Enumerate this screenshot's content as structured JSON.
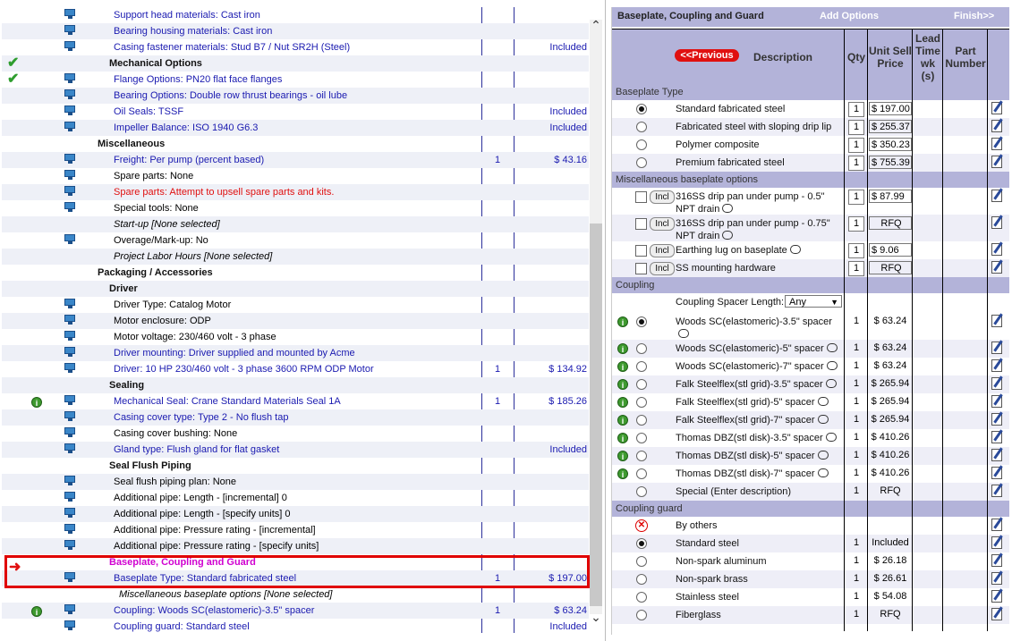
{
  "left_rows": [
    {
      "type": "item",
      "icon": true,
      "text": "Support head materials: Cast iron",
      "color": "blue",
      "qty": "",
      "price": ""
    },
    {
      "type": "item",
      "icon": true,
      "text": "Bearing housing materials: Cast iron",
      "color": "blue",
      "qty": "",
      "price": ""
    },
    {
      "type": "item",
      "icon": true,
      "text": "Casing fastener materials: Stud B7 / Nut SR2H (Steel)",
      "color": "blue",
      "qty": "",
      "price": "Included"
    },
    {
      "type": "h2",
      "check": true,
      "text": "Mechanical Options"
    },
    {
      "type": "item",
      "icon": true,
      "check": true,
      "text": "Flange Options: PN20 flat face flanges",
      "color": "blue",
      "qty": "",
      "price": ""
    },
    {
      "type": "item",
      "icon": true,
      "text": "Bearing Options: Double row thrust bearings - oil lube",
      "color": "blue",
      "qty": "",
      "price": ""
    },
    {
      "type": "item",
      "icon": true,
      "text": "Oil Seals: TSSF",
      "color": "blue",
      "qty": "",
      "price": "Included"
    },
    {
      "type": "item",
      "icon": true,
      "text": "Impeller Balance: ISO 1940 G6.3",
      "color": "blue",
      "qty": "",
      "price": "Included"
    },
    {
      "type": "h1",
      "text": "Miscellaneous"
    },
    {
      "type": "item",
      "icon": true,
      "text": "Freight: Per pump (percent based)",
      "color": "blue",
      "qty": "1",
      "price": "$ 43.16"
    },
    {
      "type": "item",
      "icon": true,
      "text": "Spare parts: None",
      "color": "black",
      "qty": "",
      "price": ""
    },
    {
      "type": "item",
      "icon": true,
      "text": "Spare parts: Attempt to upsell spare parts and kits.",
      "color": "red",
      "qty": "",
      "price": ""
    },
    {
      "type": "item",
      "icon": true,
      "text": "Special tools: None",
      "color": "black",
      "qty": "",
      "price": ""
    },
    {
      "type": "italic",
      "text": "Start-up  [None selected]"
    },
    {
      "type": "item",
      "icon": true,
      "text": "Overage/Mark-up: No",
      "color": "black",
      "qty": "",
      "price": ""
    },
    {
      "type": "italic",
      "text": "Project Labor Hours  [None selected]"
    },
    {
      "type": "h1",
      "text": "Packaging / Accessories"
    },
    {
      "type": "h2",
      "text": "Driver"
    },
    {
      "type": "item",
      "icon": true,
      "text": "Driver Type: Catalog Motor",
      "color": "black",
      "qty": "",
      "price": ""
    },
    {
      "type": "item",
      "icon": true,
      "text": "Motor enclosure: ODP",
      "color": "black",
      "qty": "",
      "price": ""
    },
    {
      "type": "item",
      "icon": true,
      "text": "Motor voltage: 230/460 volt - 3 phase",
      "color": "black",
      "qty": "",
      "price": ""
    },
    {
      "type": "item",
      "icon": true,
      "text": "Driver mounting: Driver supplied and mounted by Acme",
      "color": "blue",
      "qty": "",
      "price": ""
    },
    {
      "type": "item",
      "icon": true,
      "text": "Driver: 10 HP 230/460 volt - 3 phase 3600 RPM ODP Motor",
      "color": "blue",
      "qty": "1",
      "price": "$ 134.92"
    },
    {
      "type": "h2",
      "text": "Sealing"
    },
    {
      "type": "item",
      "icon": true,
      "info": true,
      "text": "Mechanical Seal: Crane Standard Materials Seal 1A",
      "color": "blue",
      "qty": "1",
      "price": "$ 185.26"
    },
    {
      "type": "item",
      "icon": true,
      "text": "Casing cover type: Type 2 - No flush tap",
      "color": "blue",
      "qty": "",
      "price": ""
    },
    {
      "type": "item",
      "icon": true,
      "text": "Casing cover bushing: None",
      "color": "black",
      "qty": "",
      "price": ""
    },
    {
      "type": "item",
      "icon": true,
      "text": "Gland type: Flush gland for flat gasket",
      "color": "blue",
      "qty": "",
      "price": "Included"
    },
    {
      "type": "h2",
      "text": "Seal Flush Piping"
    },
    {
      "type": "item",
      "icon": true,
      "text": "Seal flush piping plan: None",
      "color": "black",
      "qty": "",
      "price": ""
    },
    {
      "type": "item",
      "icon": true,
      "text": "Additional pipe: Length - [incremental] 0",
      "color": "black",
      "qty": "",
      "price": ""
    },
    {
      "type": "item",
      "icon": true,
      "text": "Additional pipe: Length - [specify units] 0",
      "color": "black",
      "qty": "",
      "price": ""
    },
    {
      "type": "item",
      "icon": true,
      "text": "Additional pipe: Pressure rating - [incremental]",
      "color": "black",
      "qty": "",
      "price": ""
    },
    {
      "type": "item",
      "icon": true,
      "text": "Additional pipe: Pressure rating - [specify units]",
      "color": "black",
      "qty": "",
      "price": ""
    },
    {
      "type": "magenta",
      "text": "Baseplate, Coupling and Guard"
    },
    {
      "type": "item",
      "icon": true,
      "text": "Baseplate Type: Standard fabricated steel",
      "color": "blue",
      "qty": "1",
      "price": "$ 197.00"
    },
    {
      "type": "italic2",
      "text": "Miscellaneous baseplate options  [None selected]"
    },
    {
      "type": "item",
      "icon": true,
      "info": true,
      "text": "Coupling: Woods SC(elastomeric)-3.5\" spacer",
      "color": "blue",
      "qty": "1",
      "price": "$ 63.24"
    },
    {
      "type": "item",
      "icon": true,
      "text": "Coupling guard: Standard steel",
      "color": "blue",
      "qty": "",
      "price": "Included"
    }
  ],
  "right": {
    "title": "Baseplate, Coupling and Guard",
    "add_options": "Add Options",
    "finish": "Finish>>",
    "previous": "<<Previous",
    "headers": {
      "description": "Description",
      "qty": "Qty",
      "unit_sell_price": "Unit Sell Price",
      "lead_time": "Lead Time wk (s)",
      "part_number": "Part Number"
    },
    "baseplate_section": "Baseplate Type",
    "baseplate": [
      {
        "desc": "Standard fabricated steel",
        "qty": "1",
        "price": "$ 197.00",
        "selected": true
      },
      {
        "desc": "Fabricated steel with sloping drip lip",
        "qty": "1",
        "price": "$ 255.37",
        "selected": false
      },
      {
        "desc": "Polymer composite",
        "qty": "1",
        "price": "$ 350.23",
        "selected": false
      },
      {
        "desc": "Premium fabricated steel",
        "qty": "1",
        "price": "$ 755.39",
        "selected": false
      }
    ],
    "misc_section": "Miscellaneous baseplate options",
    "incl_label": "Incl",
    "misc": [
      {
        "desc": "316SS drip pan under pump - 0.5\" NPT drain",
        "qty": "1",
        "price": "$ 87.99"
      },
      {
        "desc": "316SS drip pan under pump - 0.75\" NPT drain",
        "qty": "1",
        "price": "RFQ"
      },
      {
        "desc": "Earthing lug on baseplate",
        "qty": "1",
        "price": "$ 9.06"
      },
      {
        "desc": "SS mounting hardware",
        "qty": "1",
        "price": "RFQ"
      }
    ],
    "coupling_section": "Coupling",
    "spacer_label": "Coupling Spacer Length:",
    "spacer_value": "Any",
    "coupling": [
      {
        "desc": "Woods SC(elastomeric)-3.5\" spacer",
        "qty": "1",
        "price": "$ 63.24",
        "selected": true
      },
      {
        "desc": "Woods SC(elastomeric)-5\" spacer",
        "qty": "1",
        "price": "$ 63.24",
        "selected": false
      },
      {
        "desc": "Woods SC(elastomeric)-7\" spacer",
        "qty": "1",
        "price": "$ 63.24",
        "selected": false
      },
      {
        "desc": "Falk Steelflex(stl grid)-3.5\" spacer",
        "qty": "1",
        "price": "$ 265.94",
        "selected": false
      },
      {
        "desc": "Falk Steelflex(stl grid)-5\" spacer",
        "qty": "1",
        "price": "$ 265.94",
        "selected": false
      },
      {
        "desc": "Falk Steelflex(stl grid)-7\" spacer",
        "qty": "1",
        "price": "$ 265.94",
        "selected": false
      },
      {
        "desc": "Thomas DBZ(stl disk)-3.5\" spacer",
        "qty": "1",
        "price": "$ 410.26",
        "selected": false
      },
      {
        "desc": "Thomas DBZ(stl disk)-5\" spacer",
        "qty": "1",
        "price": "$ 410.26",
        "selected": false
      },
      {
        "desc": "Thomas DBZ(stl disk)-7\" spacer",
        "qty": "1",
        "price": "$ 410.26",
        "selected": false
      },
      {
        "desc": "Special (Enter description)",
        "qty": "1",
        "price": "RFQ",
        "selected": false
      }
    ],
    "guard_section": "Coupling guard",
    "guard": [
      {
        "desc": "By others",
        "qty": "",
        "price": "",
        "selected": false
      },
      {
        "desc": "Standard steel",
        "qty": "1",
        "price": "Included",
        "selected": true
      },
      {
        "desc": "Non-spark aluminum",
        "qty": "1",
        "price": "$ 26.18",
        "selected": false
      },
      {
        "desc": "Non-spark brass",
        "qty": "1",
        "price": "$ 26.61",
        "selected": false
      },
      {
        "desc": "Stainless steel",
        "qty": "1",
        "price": "$ 54.08",
        "selected": false
      },
      {
        "desc": "Fiberglass",
        "qty": "1",
        "price": "RFQ",
        "selected": false
      }
    ]
  },
  "colors": {
    "header_bg": "#b3b3d9",
    "link_blue": "#1a1ab0",
    "alert_red": "#e01010",
    "section_magenta": "#d000d0",
    "highlight_red": "#e00000"
  }
}
